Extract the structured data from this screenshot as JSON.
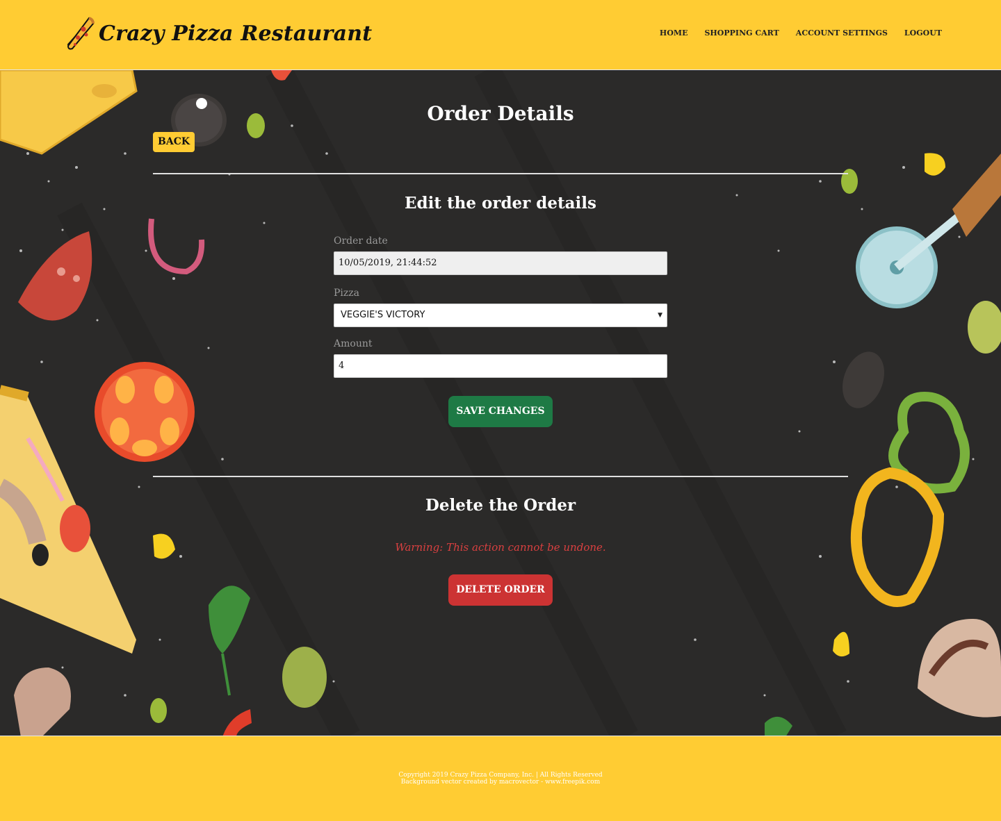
{
  "header": {
    "brand": "Crazy Pizza Restaurant",
    "logo_icon": "pizza-slice-icon",
    "nav": [
      "HOME",
      "SHOPPING CART",
      "ACCOUNT SETTINGS",
      "LOGOUT"
    ]
  },
  "main": {
    "page_title": "Order Details",
    "back_label": "BACK",
    "edit_section": {
      "title": "Edit the order details",
      "order_date_label": "Order date",
      "order_date_value": "10/05/2019, 21:44:52",
      "pizza_label": "Pizza",
      "pizza_selected": "VEGGIE'S VICTORY",
      "amount_label": "Amount",
      "amount_value": "4",
      "save_label": "SAVE CHANGES"
    },
    "delete_section": {
      "title": "Delete the Order",
      "warning": "Warning: This action cannot be undone.",
      "delete_label": "DELETE ORDER"
    }
  },
  "footer": {
    "line1": "Copyright 2019 Crazy Pizza Company, Inc. | All Rights Reserved",
    "line2": "Background vector created by macrovector - www.freepik.com"
  },
  "colors": {
    "brand_yellow": "#ffcc33",
    "background_dark": "#2b2a29",
    "save_green": "#1e7a45",
    "delete_red": "#cc3333",
    "warning_red": "#d94040"
  }
}
